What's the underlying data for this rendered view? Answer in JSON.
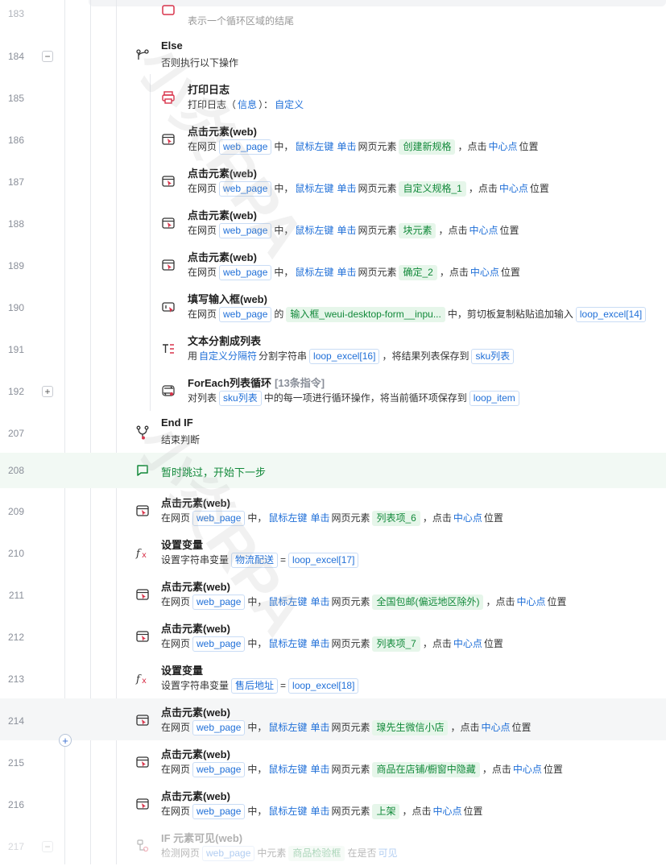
{
  "watermark": "小炎RPA",
  "colors": {
    "keyword": "#1f6fd8",
    "element_tag": "#12893a",
    "skip_highlight": "#f2f9f4",
    "line_number": "#8a8f99"
  },
  "header_partial": {
    "line": "183",
    "desc": "表示一个循环区域的结尾"
  },
  "rows": [
    {
      "line": "184",
      "title": "Else",
      "desc": "否则执行以下操作",
      "toggle": "−",
      "icon": "branch-icon"
    },
    {
      "line": "185",
      "title": "打印日志",
      "desc_prefix": "打印日志",
      "desc_open": "（",
      "kw1": "信息",
      "desc_close": "）：",
      "kw2": "自定义",
      "icon": "printer-icon"
    },
    {
      "line": "186",
      "title": "点击元素(web)",
      "p1": "在网页",
      "page": "web_page",
      "p2": "中，",
      "mouse": "鼠标左键",
      "action": "单击",
      "p3": "网页元素",
      "element": "创建新规格",
      "p4": "，点击",
      "point": "中心点",
      "p5": "位置",
      "icon": "click-element-icon"
    },
    {
      "line": "187",
      "title": "点击元素(web)",
      "p1": "在网页",
      "page": "web_page",
      "p2": "中，",
      "mouse": "鼠标左键",
      "action": "单击",
      "p3": "网页元素",
      "element": "自定义规格_1",
      "p4": "，点击",
      "point": "中心点",
      "p5": "位置",
      "icon": "click-element-icon"
    },
    {
      "line": "188",
      "title": "点击元素(web)",
      "p1": "在网页",
      "page": "web_page",
      "p2": "中，",
      "mouse": "鼠标左键",
      "action": "单击",
      "p3": "网页元素",
      "element": "块元素",
      "p4": "，点击",
      "point": "中心点",
      "p5": "位置",
      "icon": "click-element-icon"
    },
    {
      "line": "189",
      "title": "点击元素(web)",
      "p1": "在网页",
      "page": "web_page",
      "p2": "中，",
      "mouse": "鼠标左键",
      "action": "单击",
      "p3": "网页元素",
      "element": "确定_2",
      "p4": "，点击",
      "point": "中心点",
      "p5": "位置",
      "icon": "click-element-icon"
    },
    {
      "line": "190",
      "title": "填写输入框(web)",
      "p1": "在网页",
      "page": "web_page",
      "p2": "的",
      "element": "输入框_weui-desktop-form__inpu...",
      "p3": "中，剪切板复制粘贴追加输入",
      "var": "loop_excel[14]",
      "icon": "input-box-icon"
    },
    {
      "line": "191",
      "title": "文本分割成列表",
      "p1": "用",
      "kw1": "自定义分隔符",
      "p2": "分割字符串",
      "var": "loop_excel[16]",
      "p3": "，将结果列表保存到",
      "var2": "sku列表",
      "icon": "text-split-icon"
    },
    {
      "line": "192",
      "title": "ForEach列表循环",
      "extra": "[13条指令]",
      "toggle": "+",
      "p1": "对列表",
      "var": "sku列表",
      "p2": "中的每一项进行循环操作，将当前循环项保存到",
      "var2": "loop_item",
      "icon": "loop-icon"
    },
    {
      "line": "207",
      "title": "End IF",
      "desc": "结束判断",
      "icon": "end-if-icon"
    },
    {
      "line": "208",
      "skip": "暂时跳过，开始下一步",
      "icon": "comment-icon"
    },
    {
      "line": "209",
      "title": "点击元素(web)",
      "p1": "在网页",
      "page": "web_page",
      "p2": "中，",
      "mouse": "鼠标左键",
      "action": "单击",
      "p3": "网页元素",
      "element": "列表项_6",
      "p4": "，点击",
      "point": "中心点",
      "p5": "位置",
      "icon": "click-element-icon"
    },
    {
      "line": "210",
      "title": "设置变量",
      "p1": "设置字符串变量",
      "var": "物流配送",
      "eq": "=",
      "var2": "loop_excel[17]",
      "icon": "fx-icon"
    },
    {
      "line": "211",
      "title": "点击元素(web)",
      "p1": "在网页",
      "page": "web_page",
      "p2": "中，",
      "mouse": "鼠标左键",
      "action": "单击",
      "p3": "网页元素",
      "element": "全国包邮(偏远地区除外)",
      "p4": "，点击",
      "point": "中心点",
      "p5": "位置",
      "icon": "click-element-icon"
    },
    {
      "line": "212",
      "title": "点击元素(web)",
      "p1": "在网页",
      "page": "web_page",
      "p2": "中，",
      "mouse": "鼠标左键",
      "action": "单击",
      "p3": "网页元素",
      "element": "列表项_7",
      "p4": "，点击",
      "point": "中心点",
      "p5": "位置",
      "icon": "click-element-icon"
    },
    {
      "line": "213",
      "title": "设置变量",
      "p1": "设置字符串变量",
      "var": "售后地址",
      "eq": "=",
      "var2": "loop_excel[18]",
      "icon": "fx-icon"
    },
    {
      "line": "214",
      "title": "点击元素(web)",
      "p1": "在网页",
      "page": "web_page",
      "p2": "中，",
      "mouse": "鼠标左键",
      "action": "单击",
      "p3": "网页元素",
      "element": "瑔先生微信小店",
      "p4": "，点击",
      "point": "中心点",
      "p5": "位置",
      "icon": "click-element-icon"
    },
    {
      "line": "215",
      "title": "点击元素(web)",
      "p1": "在网页",
      "page": "web_page",
      "p2": "中，",
      "mouse": "鼠标左键",
      "action": "单击",
      "p3": "网页元素",
      "element": "商品在店铺/橱窗中隐藏",
      "p4": "，点击",
      "point": "中心点",
      "p5": "位置",
      "icon": "click-element-icon"
    },
    {
      "line": "216",
      "title": "点击元素(web)",
      "p1": "在网页",
      "page": "web_page",
      "p2": "中，",
      "mouse": "鼠标左键",
      "action": "单击",
      "p3": "网页元素",
      "element": "上架",
      "p4": "，点击",
      "point": "中心点",
      "p5": "位置",
      "icon": "click-element-icon"
    },
    {
      "line": "217",
      "title": "IF 元素可见(web)",
      "toggle": "−",
      "p1": "检测网页",
      "page": "web_page",
      "p2": "中元素",
      "element": "商品检验框",
      "p3": "在是否",
      "kw1": "可见",
      "icon": "if-element-icon"
    }
  ],
  "add_button": "+"
}
